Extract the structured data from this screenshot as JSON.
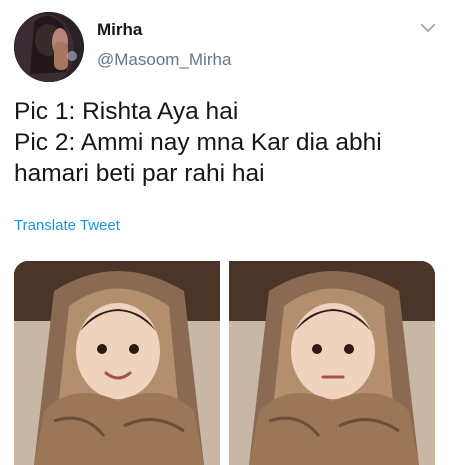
{
  "tweet": {
    "author": {
      "display_name": "Mirha",
      "handle": "@Masoom_Mirha",
      "avatar": "profile-photo"
    },
    "menu_icon": "chevron-down-icon",
    "text_lines": [
      "Pic 1: Rishta Aya hai",
      "Pic 2: Ammi nay mna Kar dia abhi",
      "hamari beti par rahi hai"
    ],
    "translate_label": "Translate Tweet",
    "link_color": "#1b95e0",
    "media": [
      {
        "name": "photo-1",
        "description": "baby-smiling-in-dupatta"
      },
      {
        "name": "photo-2",
        "description": "baby-serious-in-dupatta"
      }
    ]
  }
}
